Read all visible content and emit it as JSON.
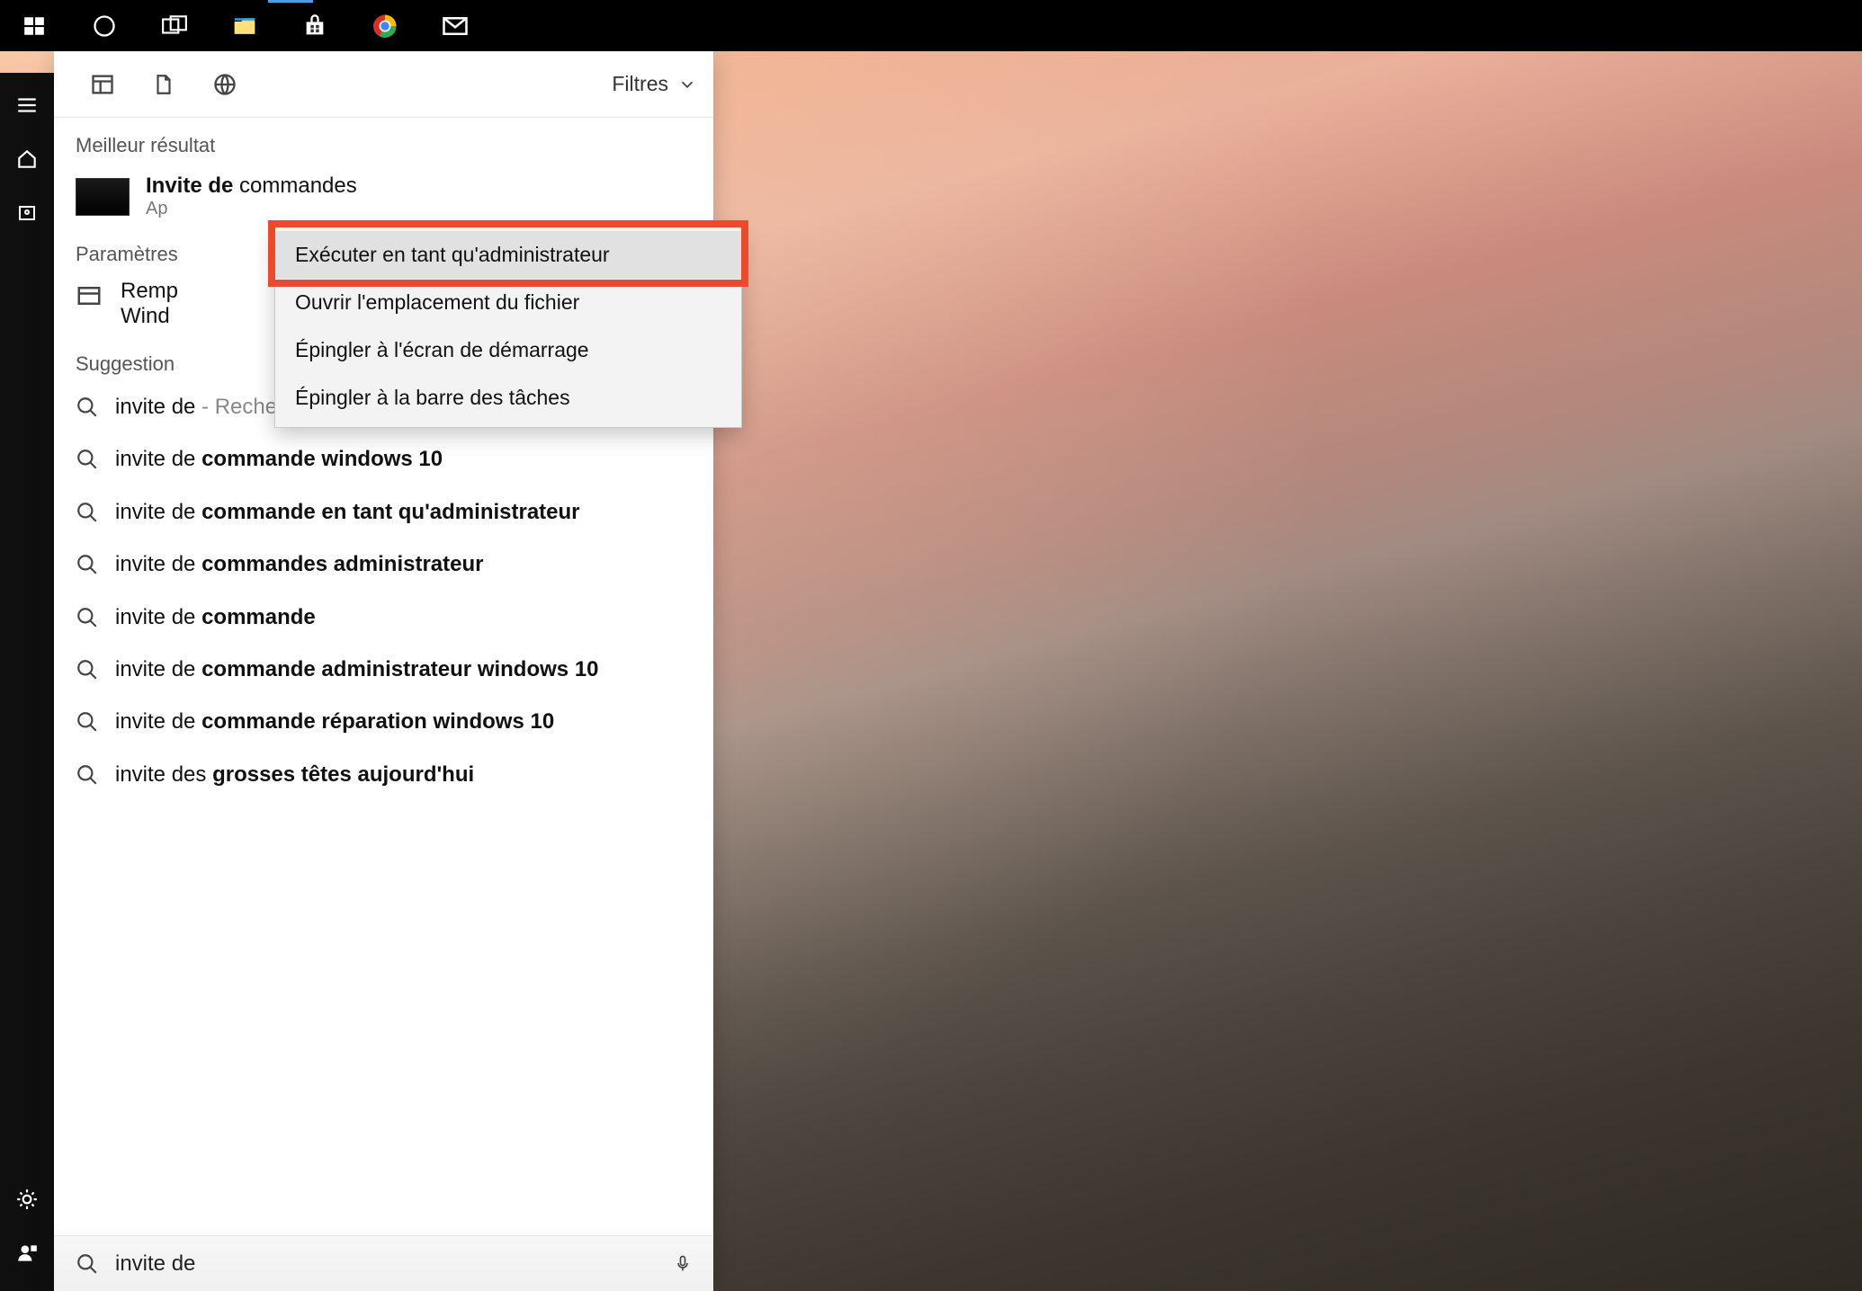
{
  "taskbar": {
    "items": [
      "start",
      "cortana",
      "task-view",
      "file-explorer",
      "store",
      "chrome",
      "mail"
    ]
  },
  "rail": {
    "items_top": [
      "menu",
      "home",
      "photos"
    ],
    "items_bottom": [
      "settings",
      "account"
    ]
  },
  "panel": {
    "filters_label": "Filtres",
    "section_best": "Meilleur résultat",
    "best_result": {
      "title_bold": "Invite de",
      "title_rest": " commandes",
      "subtitle": "Ap"
    },
    "section_settings": "Paramètres",
    "settings_item": {
      "line1": "Remp",
      "line2": "Wind"
    },
    "section_suggestions": "Suggestion",
    "suggestions": [
      {
        "pre": "invite de",
        "bold": "",
        "hint": " - Rechercher sur le Web"
      },
      {
        "pre": "invite de ",
        "bold": "commande windows 10",
        "hint": ""
      },
      {
        "pre": "invite de ",
        "bold": "commande en tant qu'administrateur",
        "hint": ""
      },
      {
        "pre": "invite de ",
        "bold": "commandes administrateur",
        "hint": ""
      },
      {
        "pre": "invite de ",
        "bold": "commande",
        "hint": ""
      },
      {
        "pre": "invite de ",
        "bold": "commande administrateur windows 10",
        "hint": ""
      },
      {
        "pre": "invite de ",
        "bold": "commande réparation windows 10",
        "hint": ""
      },
      {
        "pre": "invite des ",
        "bold": "grosses têtes aujourd'hui",
        "hint": ""
      }
    ],
    "search_value": "invite de"
  },
  "context_menu": {
    "items": [
      "Exécuter en tant qu'administrateur",
      "Ouvrir l'emplacement du fichier",
      "Épingler à l'écran de démarrage",
      "Épingler à la barre des tâches"
    ]
  }
}
